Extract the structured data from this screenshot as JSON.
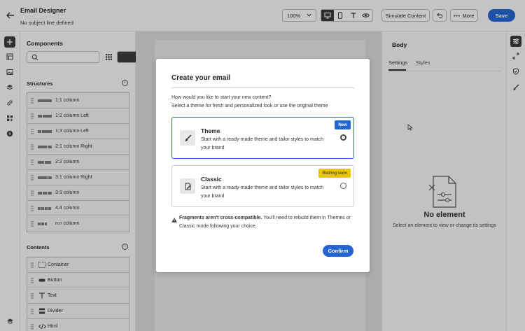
{
  "header": {
    "title": "Email Designer",
    "subtitle": "No subject line defined",
    "zoom": "100%",
    "simulate_label": "Simulate Content",
    "more_label": "More",
    "save_label": "Save"
  },
  "components": {
    "title": "Components",
    "search_placeholder": "",
    "structures_label": "Structures",
    "structures": [
      {
        "label": "1:1 column",
        "bars": [
          20
        ]
      },
      {
        "label": "1:2 column Left",
        "bars": [
          6,
          13
        ]
      },
      {
        "label": "1:3 column Left",
        "bars": [
          5,
          14
        ]
      },
      {
        "label": "2:1 column Right",
        "bars": [
          13,
          6
        ]
      },
      {
        "label": "2:2 column",
        "bars": [
          9,
          9
        ]
      },
      {
        "label": "3:1 column Right",
        "bars": [
          14,
          5
        ]
      },
      {
        "label": "3:3 column",
        "bars": [
          6,
          6,
          6
        ]
      },
      {
        "label": "4:4 column",
        "bars": [
          4,
          4,
          4,
          4
        ]
      },
      {
        "label": "n:n column",
        "bars": [
          4,
          4,
          3
        ]
      }
    ],
    "contents_label": "Contents",
    "contents": [
      {
        "label": "Container",
        "icon": "container-icon"
      },
      {
        "label": "Button",
        "icon": "button-icon"
      },
      {
        "label": "Text",
        "icon": "text-icon"
      },
      {
        "label": "Divider",
        "icon": "divider-icon"
      },
      {
        "label": "Html",
        "icon": "html-icon"
      }
    ]
  },
  "right_panel": {
    "title": "Body",
    "tabs": [
      "Settings",
      "Styles"
    ],
    "empty_title": "No element",
    "empty_subtitle": "Select an element to view or change its settings"
  },
  "modal": {
    "title": "Create your email",
    "desc_line1": "How would you like to start your new content?",
    "desc_line2": "Select a theme for fresh and personalized look or use the original theme",
    "options": [
      {
        "name": "Theme",
        "desc": "Start with a ready-made theme and tailor styles to match your brand",
        "badge": "New",
        "selected": true
      },
      {
        "name": "Classic",
        "desc": "Start with a ready-made theme and tailor styles to match your brand",
        "badge": "Retiring soon",
        "selected": false
      }
    ],
    "warning_bold": "Fragments aren't cross-compatible.",
    "warning_text": " You'll need to rebuild them in Themes or Classic mode following your choice.",
    "confirm_label": "Confirm"
  },
  "colors": {
    "accent": "#2566d3",
    "badge_retiring": "#e8c600"
  }
}
